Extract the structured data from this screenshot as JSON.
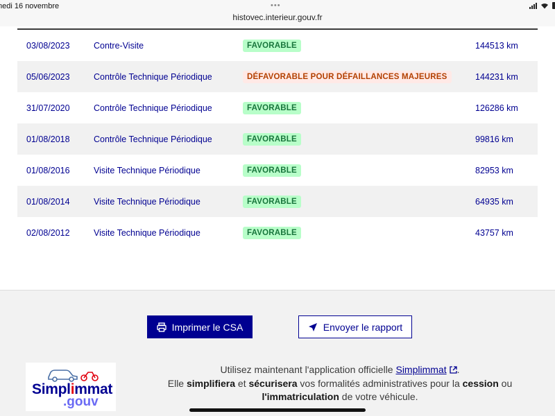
{
  "status_bar": {
    "date": "medi 16 novembre",
    "url": "histovec.interieur.gouv.fr"
  },
  "inspections": {
    "rows": [
      {
        "date": "03/08/2023",
        "type": "Contre-Visite",
        "result": "FAVORABLE",
        "status": "ok",
        "km": "144513 km"
      },
      {
        "date": "05/06/2023",
        "type": "Contrôle Technique Périodique",
        "result": "DÉFAVORABLE POUR DÉFAILLANCES MAJEURES",
        "status": "ko",
        "km": "144231 km"
      },
      {
        "date": "31/07/2020",
        "type": "Contrôle Technique Périodique",
        "result": "FAVORABLE",
        "status": "ok",
        "km": "126286 km"
      },
      {
        "date": "01/08/2018",
        "type": "Contrôle Technique Périodique",
        "result": "FAVORABLE",
        "status": "ok",
        "km": "99816 km"
      },
      {
        "date": "01/08/2016",
        "type": "Visite Technique Périodique",
        "result": "FAVORABLE",
        "status": "ok",
        "km": "82953 km"
      },
      {
        "date": "01/08/2014",
        "type": "Visite Technique Périodique",
        "result": "FAVORABLE",
        "status": "ok",
        "km": "64935 km"
      },
      {
        "date": "02/08/2012",
        "type": "Visite Technique Périodique",
        "result": "FAVORABLE",
        "status": "ok",
        "km": "43757 km"
      }
    ]
  },
  "actions": {
    "print_label": "Imprimer le CSA",
    "send_label": "Envoyer le rapport"
  },
  "promo": {
    "logo_word_a": "Simpl",
    "logo_word_b": "i",
    "logo_word_c": "mmat",
    "logo_gouv": ".gouv",
    "line1_prefix": "Utilisez maintenant l'application officielle ",
    "line1_link": "Simplimmat",
    "line1_suffix": ".",
    "line2_a": "Elle ",
    "line2_b": "simplifiera",
    "line2_c": " et ",
    "line2_d": "sécurisera",
    "line2_e": " vos formalités administratives pour la ",
    "line2_f": "cession",
    "line2_g": " ou",
    "line3_a": "l'immatriculation",
    "line3_b": " de votre véhicule."
  },
  "colors": {
    "primary": "#000091",
    "favorable_bg": "#b8fec9",
    "favorable_text": "#18753c",
    "defavorable_bg": "#ffe9e6",
    "defavorable_text": "#b34000"
  }
}
